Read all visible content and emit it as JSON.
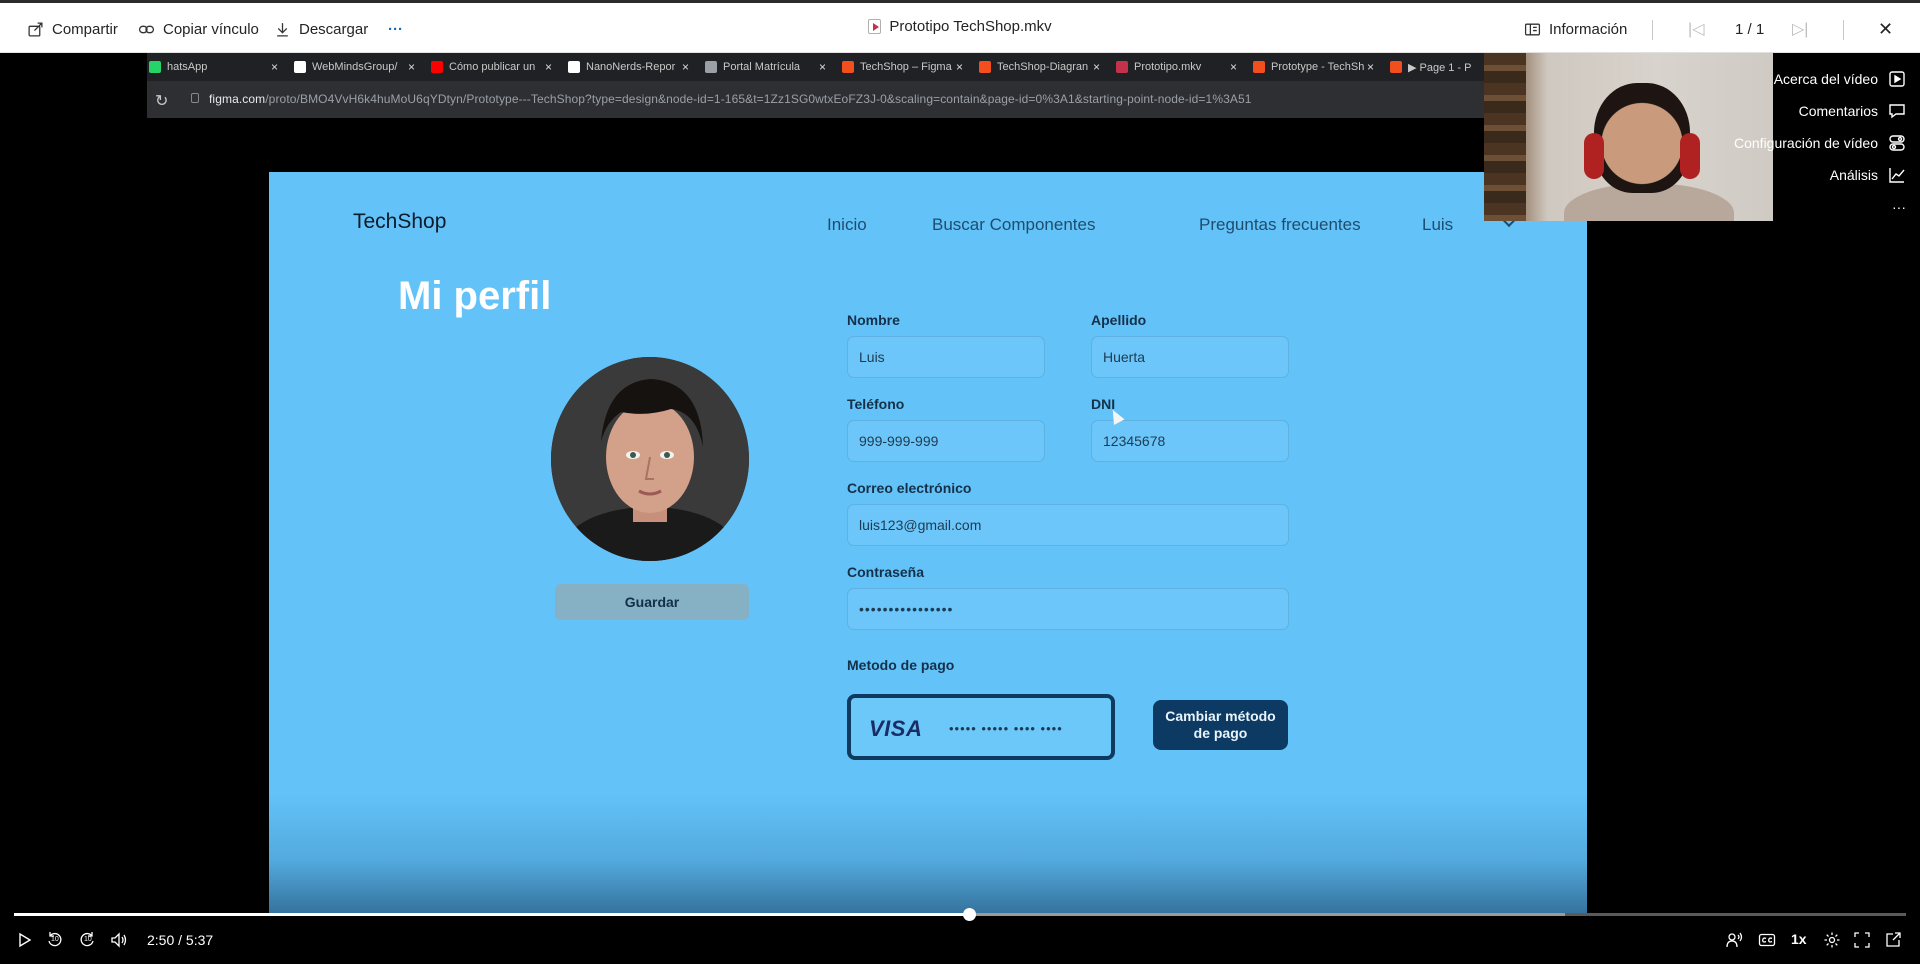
{
  "toolbar": {
    "share_label": "Compartir",
    "copy_link_label": "Copiar vínculo",
    "download_label": "Descargar",
    "more_label": "···",
    "file_title": "Prototipo TechShop.mkv",
    "info_label": "Información",
    "page_counter": "1 / 1"
  },
  "recording": {
    "browser_tabs": [
      {
        "label": "hatsApp",
        "color": "#25d366"
      },
      {
        "label": "WebMindsGroup/",
        "color": "#ffffff"
      },
      {
        "label": "Cómo publicar un",
        "color": "#ff0000"
      },
      {
        "label": "NanoNerds-Repor",
        "color": "#ffffff"
      },
      {
        "label": "Portal Matrícula",
        "color": "#9aa0a6"
      },
      {
        "label": "TechShop – Figma",
        "color": "#f24e1e"
      },
      {
        "label": "TechShop-Diagran",
        "color": "#f24e1e"
      },
      {
        "label": "Prototipo.mkv",
        "color": "#c4314b"
      },
      {
        "label": "Prototype - TechSh",
        "color": "#f24e1e"
      },
      {
        "label": "▶ Page 1 - P",
        "color": "#f24e1e"
      }
    ],
    "url_domain": "figma.com",
    "url_path": "/proto/BMO4VvH6k4huMoU6qYDtyn/Prototype---TechShop?type=design&node-id=1-165&t=1Zz1SG0wtxEoFZ3J-0&scaling=contain&page-id=0%3A1&starting-point-node-id=1%3A51"
  },
  "app": {
    "brand": "TechShop",
    "nav": {
      "home": "Inicio",
      "search": "Buscar Componentes",
      "faq": "Preguntas frecuentes",
      "user": "Luis"
    },
    "page_title": "Mi perfil",
    "save_button": "Guardar",
    "form": {
      "first_name_label": "Nombre",
      "first_name_value": "Luis",
      "last_name_label": "Apellido",
      "last_name_value": "Huerta",
      "phone_label": "Teléfono",
      "phone_value": "999-999-999",
      "dni_label": "DNI",
      "dni_value": "12345678",
      "email_label": "Correo electrónico",
      "email_value": "luis123@gmail.com",
      "password_label": "Contraseña",
      "password_value": "••••••••••••••••",
      "payment_label": "Metodo de pago",
      "card_brand": "VISA",
      "card_number": "••••• ••••• •••• ••••",
      "change_payment_line1": "Cambiar método",
      "change_payment_line2": "de pago"
    }
  },
  "side_panel": {
    "about": "Acerca del vídeo",
    "comments": "Comentarios",
    "settings": "Configuración de vídeo",
    "analytics": "Análisis",
    "more": "···"
  },
  "player": {
    "time": "2:50 / 5:37",
    "progress": 0.505,
    "buffered": 0.82,
    "skip_back_seconds": "10",
    "skip_forward_seconds": "10",
    "speed": "1x"
  }
}
